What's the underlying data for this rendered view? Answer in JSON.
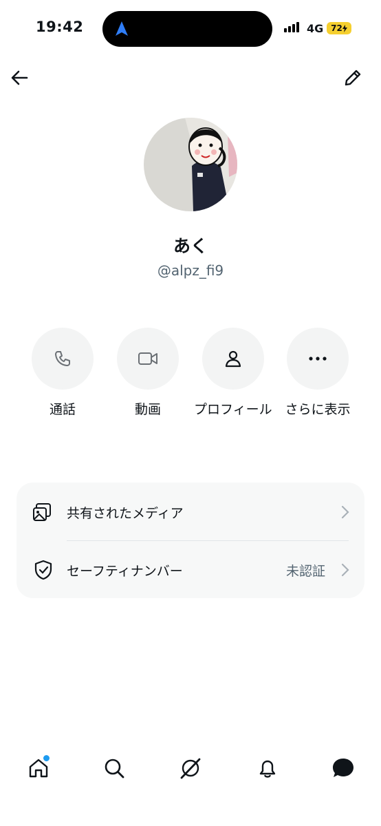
{
  "status_bar": {
    "time": "19:42",
    "network": "4G",
    "battery": "72"
  },
  "icons": {
    "back": "arrow-left-icon",
    "edit": "pencil-icon"
  },
  "profile": {
    "display_name": "あく",
    "handle": "@alpz_fi9"
  },
  "actions": [
    {
      "label": "通話",
      "icon": "phone-icon"
    },
    {
      "label": "動画",
      "icon": "video-icon"
    },
    {
      "label": "プロフィール",
      "icon": "person-icon"
    },
    {
      "label": "さらに表示",
      "icon": "more-icon"
    }
  ],
  "settings": [
    {
      "label": "共有されたメディア",
      "status": "",
      "icon": "shared-media-icon"
    },
    {
      "label": "セーフティナンバー",
      "status": "未認証",
      "icon": "shield-check-icon"
    }
  ],
  "bottom_nav": [
    "home-icon",
    "search-icon",
    "grok-icon",
    "bell-icon",
    "messages-icon"
  ],
  "colors": {
    "accent": "#1d9bf0",
    "battery": "#f5cf2f",
    "secondary_text": "#536471",
    "card_bg": "#f7f8f8",
    "action_bg": "#f3f4f4"
  }
}
